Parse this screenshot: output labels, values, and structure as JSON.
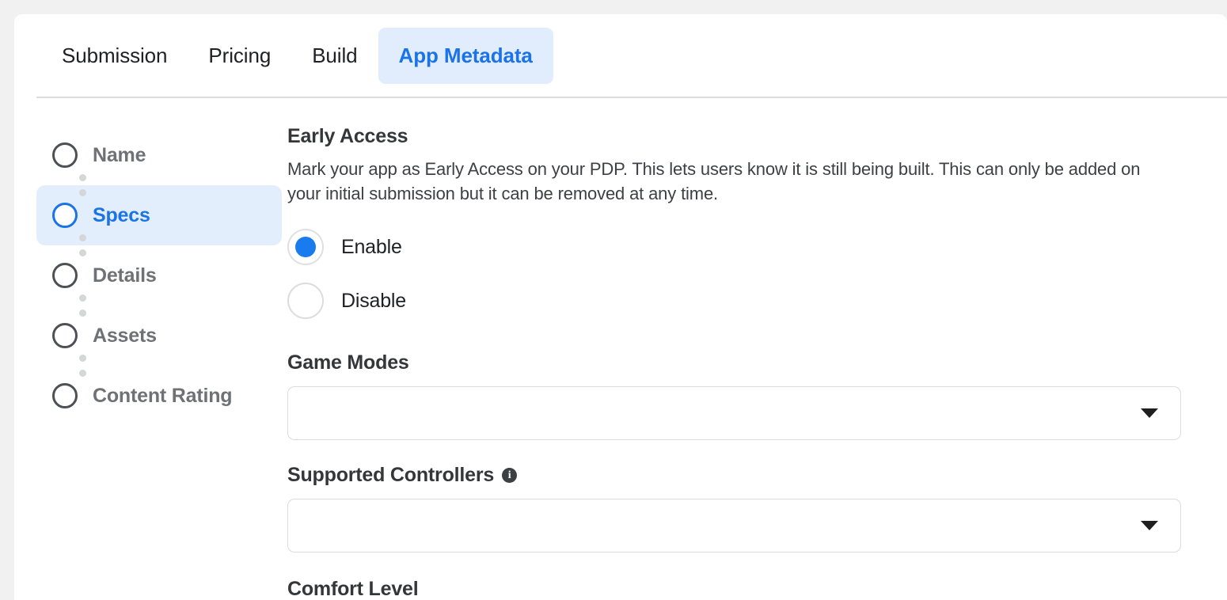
{
  "theme": {
    "page_background": "#f1f1f1",
    "card_background": "#ffffff",
    "accent_blue": "#1a73e8",
    "active_tab_background": "#e1ecfd",
    "active_step_background": "#e3eefc",
    "radio_selected_color": "#1a7bef",
    "muted_label_color": "#6e7276",
    "border_color": "#dadce0"
  },
  "tabs": [
    {
      "label": "Submission",
      "active": false
    },
    {
      "label": "Pricing",
      "active": false
    },
    {
      "label": "Build",
      "active": false
    },
    {
      "label": "App Metadata",
      "active": true
    }
  ],
  "stepper": {
    "items": [
      {
        "label": "Name",
        "active": false
      },
      {
        "label": "Specs",
        "active": true
      },
      {
        "label": "Details",
        "active": false
      },
      {
        "label": "Assets",
        "active": false
      },
      {
        "label": "Content Rating",
        "active": false
      }
    ]
  },
  "main": {
    "early_access": {
      "title": "Early Access",
      "description": "Mark your app as Early Access on your PDP. This lets users know it is still being built. This can only be added on your initial submission but it can be removed at any time.",
      "options": [
        {
          "label": "Enable",
          "selected": true
        },
        {
          "label": "Disable",
          "selected": false
        }
      ]
    },
    "game_modes": {
      "title": "Game Modes",
      "value": "",
      "caret_icon": "chevron-down-icon"
    },
    "supported_controllers": {
      "title": "Supported Controllers",
      "info_icon": "info-icon",
      "info_glyph": "i",
      "value": "",
      "caret_icon": "chevron-down-icon"
    },
    "comfort_level": {
      "title": "Comfort Level"
    }
  }
}
